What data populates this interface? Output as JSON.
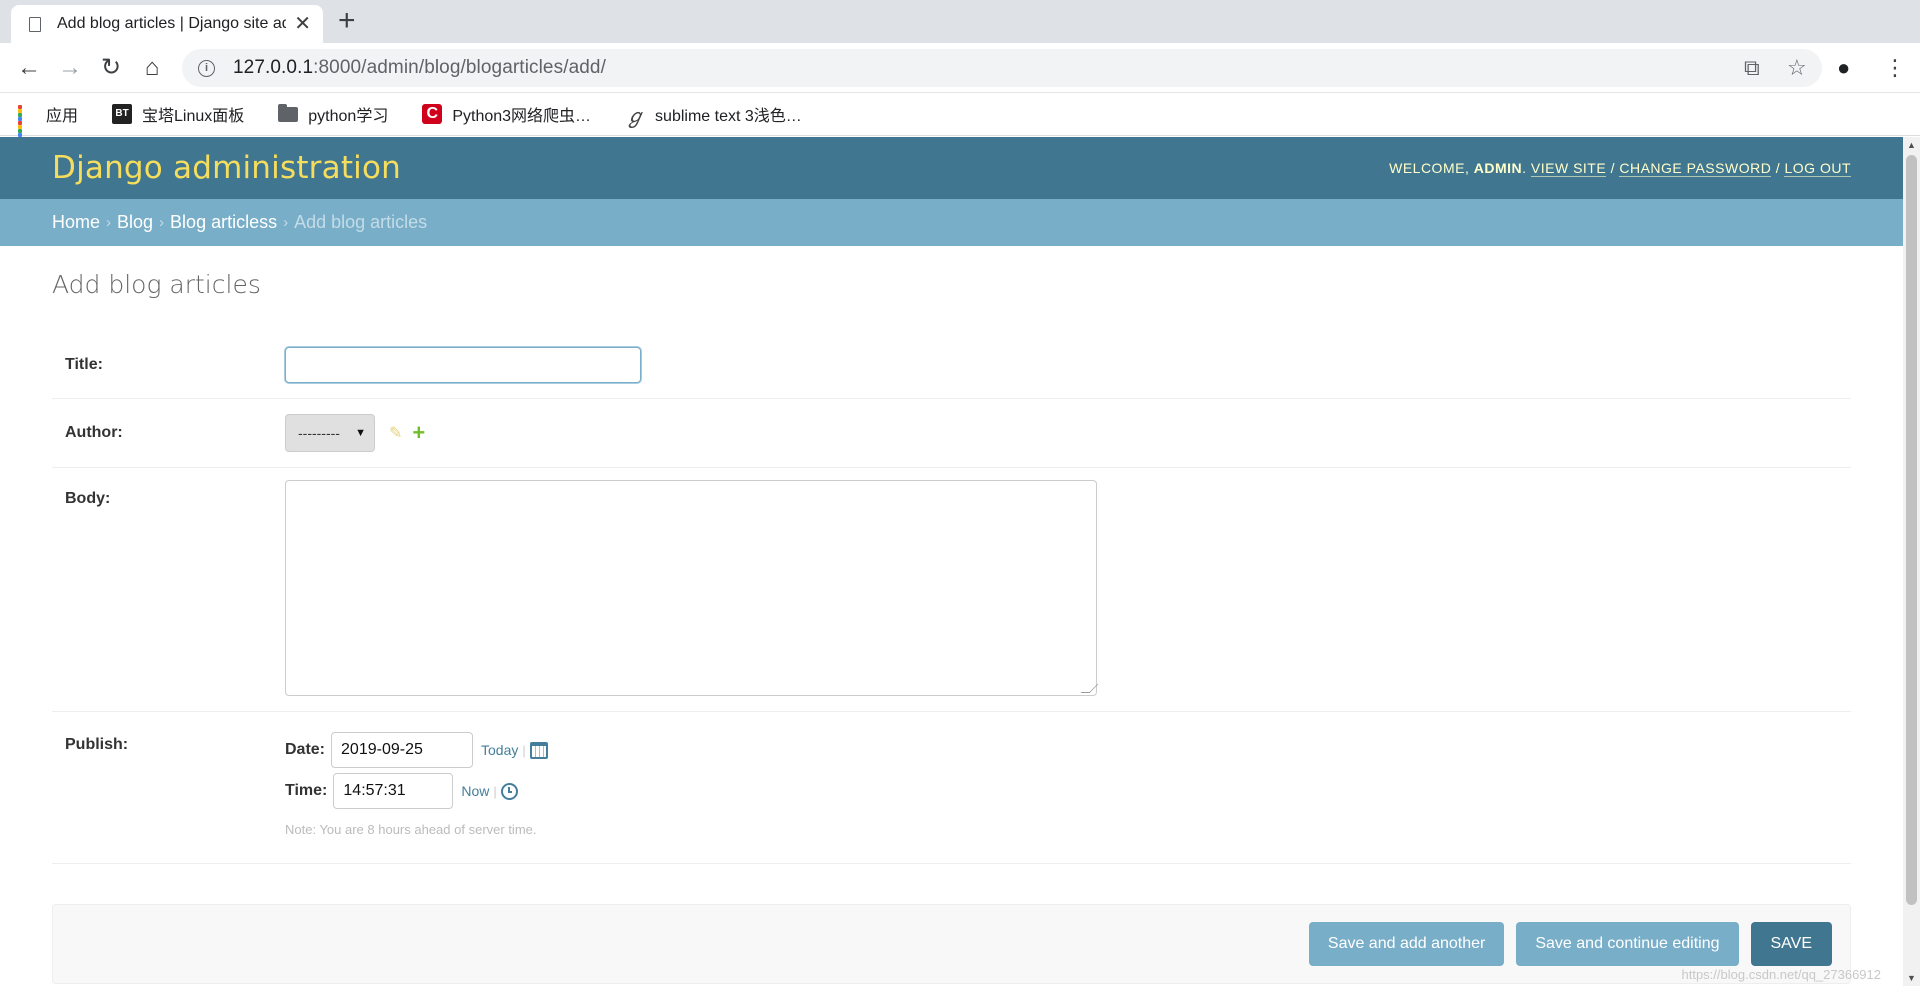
{
  "browser": {
    "tab_title": "Add blog articles | Django site admin",
    "url_host": "127.0.0.1",
    "url_rest": ":8000/admin/blog/blogarticles/add/",
    "bookmarks": [
      {
        "label": "应用"
      },
      {
        "label": "宝塔Linux面板"
      },
      {
        "label": "python学习"
      },
      {
        "label": "Python3网络爬虫…"
      },
      {
        "label": "sublime text 3浅色…"
      }
    ],
    "bt_icon_text": "BT",
    "c_icon_text": "C"
  },
  "header": {
    "branding": "Django administration",
    "welcome": "Welcome,",
    "user": "admin",
    "view_site": "View site",
    "change_password": "Change password",
    "log_out": "Log out"
  },
  "breadcrumbs": {
    "home": "Home",
    "app": "Blog",
    "model": "Blog articless",
    "current": "Add blog articles"
  },
  "form": {
    "heading": "Add blog articles",
    "title_label": "Title:",
    "title_value": "",
    "author_label": "Author:",
    "author_selected": "---------",
    "body_label": "Body:",
    "publish_label": "Publish:",
    "date_label": "Date:",
    "date_value": "2019-09-25",
    "today_link": "Today",
    "time_label": "Time:",
    "time_value": "14:57:31",
    "now_link": "Now",
    "note": "Note: You are 8 hours ahead of server time."
  },
  "actions": {
    "save_add_another": "Save and add another",
    "save_continue": "Save and continue editing",
    "save": "SAVE"
  },
  "watermark": "https://blog.csdn.net/qq_27366912",
  "colors": {
    "header_bg": "#417690",
    "breadcrumbs_bg": "#79aec8",
    "branding": "#f5dd5d",
    "primary_button": "#417690",
    "secondary_button": "#79aec8"
  }
}
